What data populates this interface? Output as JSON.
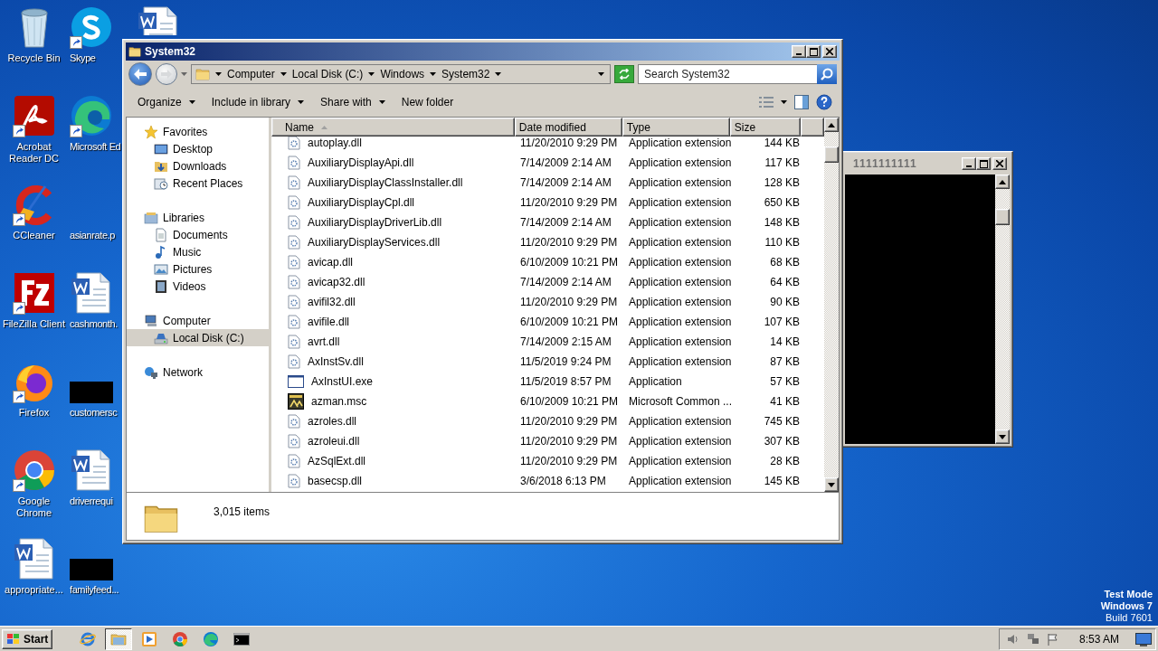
{
  "desktop": {
    "icons": [
      {
        "label": "Recycle Bin",
        "kind": "recycle",
        "shortcut": false
      },
      {
        "label": "Acrobat Reader DC",
        "kind": "acrobat",
        "shortcut": true
      },
      {
        "label": "CCleaner",
        "kind": "ccleaner",
        "shortcut": true
      },
      {
        "label": "FileZilla Client",
        "kind": "filezilla",
        "shortcut": true
      },
      {
        "label": "Firefox",
        "kind": "firefox",
        "shortcut": true
      },
      {
        "label": "Google Chrome",
        "kind": "chrome",
        "shortcut": true
      },
      {
        "label": "appropriate...",
        "kind": "word",
        "shortcut": false
      },
      {
        "label": "Skype",
        "kind": "skype",
        "shortcut": true
      },
      {
        "label": "Microsoft Ed",
        "kind": "edge",
        "shortcut": true
      },
      {
        "label": "asianrate.p",
        "kind": "blank",
        "shortcut": false
      },
      {
        "label": "cashmonth.",
        "kind": "word",
        "shortcut": false
      },
      {
        "label": "customersc",
        "kind": "redacted",
        "shortcut": false
      },
      {
        "label": "driverrequi",
        "kind": "word",
        "shortcut": false
      },
      {
        "label": "familyfeed...",
        "kind": "redacted",
        "shortcut": false
      },
      {
        "kind": "word"
      }
    ],
    "notice": [
      "Test Mode",
      "Windows 7",
      "Build 7601"
    ]
  },
  "console": {
    "title": "1111111111"
  },
  "explorer": {
    "title": "System32",
    "breadcrumb": [
      "Computer",
      "Local Disk (C:)",
      "Windows",
      "System32"
    ],
    "search": {
      "placeholder": "Search System32"
    },
    "toolbar": [
      {
        "label": "Organize",
        "dropdown": true
      },
      {
        "label": "Include in library",
        "dropdown": true
      },
      {
        "label": "Share with",
        "dropdown": true
      },
      {
        "label": "New folder",
        "dropdown": false
      }
    ],
    "nav": [
      {
        "label": "Favorites",
        "kind": "star",
        "selected": false,
        "children": [
          {
            "label": "Desktop",
            "kind": "desktop",
            "selected": false
          },
          {
            "label": "Downloads",
            "kind": "downloads",
            "selected": false
          },
          {
            "label": "Recent Places",
            "kind": "recent",
            "selected": false
          }
        ]
      },
      {
        "label": "Libraries",
        "kind": "library",
        "selected": false,
        "children": [
          {
            "label": "Documents",
            "kind": "documents",
            "selected": false
          },
          {
            "label": "Music",
            "kind": "music",
            "selected": false
          },
          {
            "label": "Pictures",
            "kind": "pictures",
            "selected": false
          },
          {
            "label": "Videos",
            "kind": "videos",
            "selected": false
          }
        ]
      },
      {
        "label": "Computer",
        "kind": "computer",
        "selected": false,
        "children": [
          {
            "label": "Local Disk (C:)",
            "kind": "drive",
            "selected": true
          }
        ]
      },
      {
        "label": "Network",
        "kind": "network",
        "selected": false
      }
    ],
    "columns": [
      {
        "label": "Name",
        "sorted": true
      },
      {
        "label": "Date modified",
        "sorted": false
      },
      {
        "label": "Type",
        "sorted": false
      },
      {
        "label": "Size",
        "sorted": false
      }
    ],
    "rows": [
      {
        "name": "autoplay.dll",
        "kind": "dll",
        "date": "11/20/2010 9:29 PM",
        "type": "Application extension",
        "size": "144 KB"
      },
      {
        "name": "AuxiliaryDisplayApi.dll",
        "kind": "dll",
        "date": "7/14/2009 2:14 AM",
        "type": "Application extension",
        "size": "117 KB"
      },
      {
        "name": "AuxiliaryDisplayClassInstaller.dll",
        "kind": "dll",
        "date": "7/14/2009 2:14 AM",
        "type": "Application extension",
        "size": "128 KB"
      },
      {
        "name": "AuxiliaryDisplayCpl.dll",
        "kind": "dll",
        "date": "11/20/2010 9:29 PM",
        "type": "Application extension",
        "size": "650 KB"
      },
      {
        "name": "AuxiliaryDisplayDriverLib.dll",
        "kind": "dll",
        "date": "7/14/2009 2:14 AM",
        "type": "Application extension",
        "size": "148 KB"
      },
      {
        "name": "AuxiliaryDisplayServices.dll",
        "kind": "dll",
        "date": "11/20/2010 9:29 PM",
        "type": "Application extension",
        "size": "110 KB"
      },
      {
        "name": "avicap.dll",
        "kind": "dll",
        "date": "6/10/2009 10:21 PM",
        "type": "Application extension",
        "size": "68 KB"
      },
      {
        "name": "avicap32.dll",
        "kind": "dll",
        "date": "7/14/2009 2:14 AM",
        "type": "Application extension",
        "size": "64 KB"
      },
      {
        "name": "avifil32.dll",
        "kind": "dll",
        "date": "11/20/2010 9:29 PM",
        "type": "Application extension",
        "size": "90 KB"
      },
      {
        "name": "avifile.dll",
        "kind": "dll",
        "date": "6/10/2009 10:21 PM",
        "type": "Application extension",
        "size": "107 KB"
      },
      {
        "name": "avrt.dll",
        "kind": "dll",
        "date": "7/14/2009 2:15 AM",
        "type": "Application extension",
        "size": "14 KB"
      },
      {
        "name": "AxInstSv.dll",
        "kind": "dll",
        "date": "11/5/2019 9:24 PM",
        "type": "Application extension",
        "size": "87 KB"
      },
      {
        "name": "AxInstUI.exe",
        "kind": "exe",
        "date": "11/5/2019 8:57 PM",
        "type": "Application",
        "size": "57 KB"
      },
      {
        "name": "azman.msc",
        "kind": "msc",
        "date": "6/10/2009 10:21 PM",
        "type": "Microsoft Common ...",
        "size": "41 KB"
      },
      {
        "name": "azroles.dll",
        "kind": "dll",
        "date": "11/20/2010 9:29 PM",
        "type": "Application extension",
        "size": "745 KB"
      },
      {
        "name": "azroleui.dll",
        "kind": "dll",
        "date": "11/20/2010 9:29 PM",
        "type": "Application extension",
        "size": "307 KB"
      },
      {
        "name": "AzSqlExt.dll",
        "kind": "dll",
        "date": "11/20/2010 9:29 PM",
        "type": "Application extension",
        "size": "28 KB"
      },
      {
        "name": "basecsp.dll",
        "kind": "dll",
        "date": "3/6/2018 6:13 PM",
        "type": "Application extension",
        "size": "145 KB"
      }
    ],
    "status": "3,015 items"
  },
  "taskbar": {
    "start": "Start",
    "apps": [
      {
        "kind": "ie",
        "active": false
      },
      {
        "kind": "explorer",
        "active": true
      },
      {
        "kind": "media",
        "active": false
      },
      {
        "kind": "chrome",
        "active": false
      },
      {
        "kind": "edge",
        "active": false
      },
      {
        "kind": "cmd",
        "active": false
      }
    ],
    "clock": "8:53 AM"
  }
}
